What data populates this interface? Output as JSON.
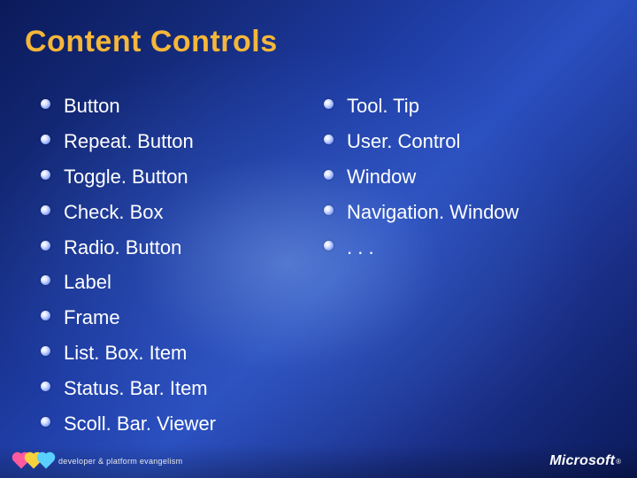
{
  "title": "Content Controls",
  "left_column": [
    "Button",
    "Repeat. Button",
    "Toggle. Button",
    "Check. Box",
    "Radio. Button",
    "Label",
    "Frame",
    "List. Box. Item",
    "Status. Bar. Item",
    "Scoll. Bar. Viewer"
  ],
  "right_column": [
    "Tool. Tip",
    "User. Control",
    "Window",
    "Navigation. Window",
    ". . ."
  ],
  "footer": {
    "left_text": "developer & platform evangelism",
    "brand": "Microsoft",
    "reg": "®"
  }
}
